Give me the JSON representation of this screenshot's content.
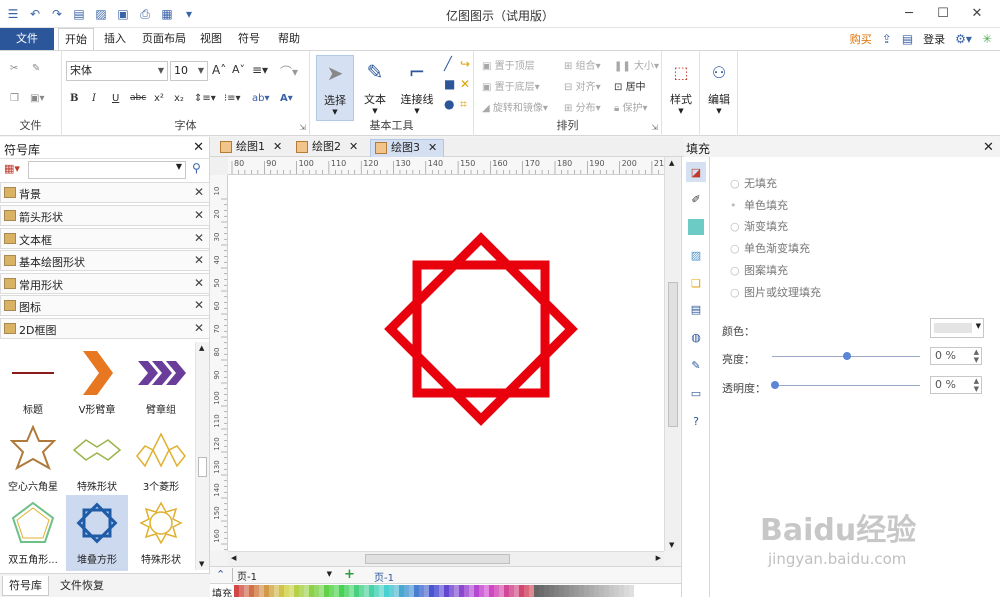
{
  "app": {
    "title": "亿图图示（试用版）"
  },
  "menu": {
    "file": "文件",
    "tabs": [
      "开始",
      "插入",
      "页面布局",
      "视图",
      "符号",
      "帮助"
    ],
    "buy": "购买",
    "login": "登录"
  },
  "ribbon": {
    "file_group": "文件",
    "font_group": "字体",
    "font_name": "宋体",
    "font_size": "10",
    "tools_group": "基本工具",
    "select": "选择",
    "text": "文本",
    "connector": "连接线",
    "arrange_group": "排列",
    "arrange": [
      "置于顶层",
      "置于底层",
      "旋转和镜像",
      "组合",
      "对齐",
      "分布",
      "大小",
      "居中",
      "保护"
    ],
    "style": "样式",
    "edit": "编辑"
  },
  "library": {
    "title": "符号库",
    "categories": [
      "背景",
      "箭头形状",
      "文本框",
      "基本绘图形状",
      "常用形状",
      "图标",
      "2D框图"
    ],
    "shapes": [
      "标题",
      "V形臂章",
      "臂章组",
      "空心六角星",
      "特殊形状",
      "3个菱形",
      "双五角形...",
      "堆叠方形",
      "特殊形状"
    ],
    "tabs": [
      "符号库",
      "文件恢复"
    ]
  },
  "documents": {
    "tabs": [
      "绘图1",
      "绘图2",
      "绘图3"
    ]
  },
  "ruler": {
    "top": [
      "80",
      "90",
      "100",
      "110",
      "120",
      "130",
      "140",
      "150",
      "160",
      "170",
      "180",
      "190",
      "200",
      "210"
    ],
    "left": [
      "10",
      "20",
      "30",
      "40",
      "50",
      "60",
      "70",
      "80",
      "90",
      "100",
      "110",
      "120",
      "130",
      "140",
      "150",
      "160"
    ]
  },
  "pagebar": {
    "page_select": "页-1",
    "page_tab": "页-1",
    "fill_label": "填充"
  },
  "fill": {
    "title": "填充",
    "options": [
      "无填充",
      "单色填充",
      "渐变填充",
      "单色渐变填充",
      "图案填充",
      "图片或纹理填充"
    ],
    "color_label": "颜色：",
    "brightness_label": "亮度：",
    "brightness_value": "0 %",
    "transparency_label": "透明度：",
    "transparency_value": "0 %"
  },
  "colors": {
    "accent": "#2b579a",
    "shape_red": "#e8000c",
    "selected_tab": "#d4e0f1"
  },
  "watermark": {
    "brand": "Baidu经验",
    "url": "jingyan.baidu.com"
  }
}
